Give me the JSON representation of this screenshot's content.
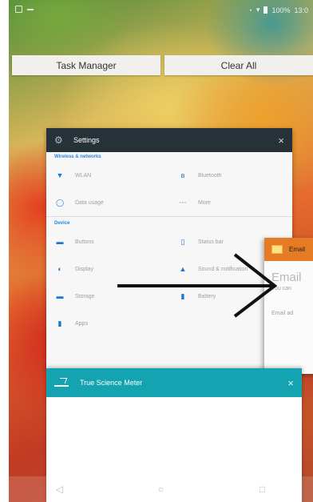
{
  "status_bar": {
    "battery": "100%",
    "time": "13:0"
  },
  "top_buttons": {
    "task_manager": "Task Manager",
    "clear_all": "Clear All"
  },
  "settings_card": {
    "title": "Settings",
    "close": "×",
    "sections": [
      {
        "label": "Wireless & networks",
        "items": [
          {
            "icon": "wifi-icon",
            "label": "WLAN"
          },
          {
            "icon": "bluetooth-icon",
            "label": "Bluetooth"
          },
          {
            "icon": "data-usage-icon",
            "label": "Data usage"
          },
          {
            "icon": "more-icon",
            "label": "More"
          }
        ]
      },
      {
        "label": "Device",
        "items": [
          {
            "icon": "buttons-icon",
            "label": "Buttons"
          },
          {
            "icon": "status-bar-icon",
            "label": "Status bar"
          },
          {
            "icon": "display-icon",
            "label": "Display"
          },
          {
            "icon": "sound-icon",
            "label": "Sound & notification"
          },
          {
            "icon": "storage-icon",
            "label": "Storage"
          },
          {
            "icon": "battery-icon",
            "label": "Battery"
          },
          {
            "icon": "apps-icon",
            "label": "Apps"
          }
        ]
      }
    ]
  },
  "email_card": {
    "title": "Email",
    "heading": "Email",
    "subtitle": "You can",
    "field_label": "Email ad"
  },
  "tsm_card": {
    "title": "True Science Meter",
    "close": "×"
  },
  "nav_bar": {
    "back": "◁",
    "home": "○",
    "recents": "□"
  },
  "colors": {
    "settings_header": "#263238",
    "accent_blue": "#1976d2",
    "email_header": "#e57c24",
    "tsm_header": "#13a3b1"
  }
}
